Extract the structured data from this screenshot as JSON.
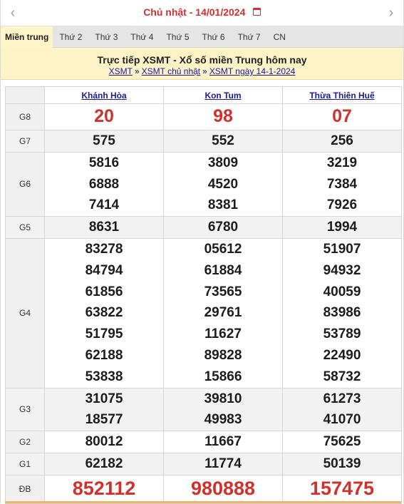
{
  "datebar": {
    "prev_icon": "chevron-left-icon",
    "label": "Chủ nhật -  14/01/2024",
    "calendar_icon": "calendar-icon",
    "next_icon": "chevron-right-icon"
  },
  "tabs": [
    {
      "label": "Miền trung",
      "active": true
    },
    {
      "label": "Thứ 2"
    },
    {
      "label": "Thứ 3"
    },
    {
      "label": "Thứ 4"
    },
    {
      "label": "Thứ 5"
    },
    {
      "label": "Thứ 6"
    },
    {
      "label": "Thứ 7"
    },
    {
      "label": "CN"
    }
  ],
  "banner": {
    "title": "Trực tiếp XSMT - Xổ số miền Trung hôm nay",
    "crumbs": [
      "XSMT",
      "XSMT chủ nhật",
      "XSMT ngày 14-1-2024"
    ],
    "separator": "»"
  },
  "provinces": [
    "Khánh Hòa",
    "Kon Tum",
    "Thừa Thiên Huế"
  ],
  "prizes": [
    {
      "label": "G8",
      "values": [
        [
          "20"
        ],
        [
          "98"
        ],
        [
          "07"
        ]
      ],
      "highlight": true
    },
    {
      "label": "G7",
      "values": [
        [
          "575"
        ],
        [
          "552"
        ],
        [
          "256"
        ]
      ]
    },
    {
      "label": "G6",
      "values": [
        [
          "5816",
          "6888",
          "7414"
        ],
        [
          "3809",
          "4520",
          "8381"
        ],
        [
          "3219",
          "7384",
          "7926"
        ]
      ]
    },
    {
      "label": "G5",
      "values": [
        [
          "8631"
        ],
        [
          "6780"
        ],
        [
          "1994"
        ]
      ]
    },
    {
      "label": "G4",
      "values": [
        [
          "83278",
          "84794",
          "61856",
          "63822",
          "51795",
          "62188",
          "53838"
        ],
        [
          "05612",
          "61884",
          "73565",
          "29761",
          "11627",
          "89828",
          "15866"
        ],
        [
          "51907",
          "94932",
          "40059",
          "83986",
          "53789",
          "22490",
          "58732"
        ]
      ]
    },
    {
      "label": "G3",
      "values": [
        [
          "31075",
          "18577"
        ],
        [
          "39810",
          "49983"
        ],
        [
          "61273",
          "41070"
        ]
      ]
    },
    {
      "label": "G2",
      "values": [
        [
          "80012"
        ],
        [
          "11667"
        ],
        [
          "75625"
        ]
      ]
    },
    {
      "label": "G1",
      "values": [
        [
          "62182"
        ],
        [
          "11774"
        ],
        [
          "50139"
        ]
      ]
    },
    {
      "label": "ĐB",
      "values": [
        [
          "852112"
        ],
        [
          "980888"
        ],
        [
          "157475"
        ]
      ],
      "highlight": true
    }
  ],
  "colors": {
    "accent_red": "#d0312d",
    "link_blue": "#1a1a9a",
    "banner_bg": "#fdf3c7",
    "tab_bar_bg": "#e5e5e5"
  }
}
